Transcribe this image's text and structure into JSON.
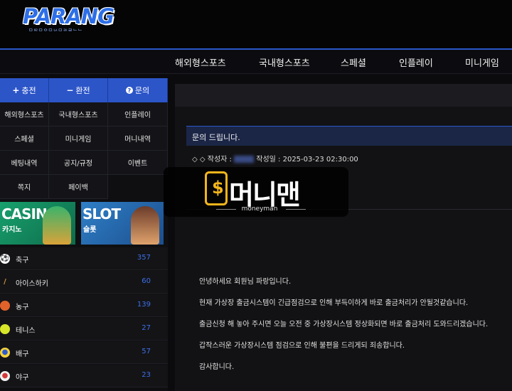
{
  "brand": {
    "logo_text": "PARANG",
    "logo_tagline": "ᄆᄋᄅᄆᄋᄆᄂᄉᄆᄅᄉᄅᄂᄂ",
    "accent": "#2c55c8"
  },
  "nav": {
    "items": [
      "해외형스포츠",
      "국내형스포츠",
      "스페셜",
      "인플레이",
      "미니게임"
    ]
  },
  "sidebar": {
    "actions": [
      {
        "icon": "plus-icon",
        "glyph": "+",
        "label": "충전"
      },
      {
        "icon": "minus-icon",
        "glyph": "−",
        "label": "환전"
      },
      {
        "icon": "question-icon",
        "glyph": "?",
        "label": "문의"
      }
    ],
    "menu": [
      "해외형스포츠",
      "국내형스포츠",
      "인플레이",
      "스페셜",
      "미니게임",
      "머니내역",
      "베팅내역",
      "공지/규정",
      "이벤트",
      "쪽지",
      "페이백"
    ],
    "banners": [
      {
        "title": "CASINO",
        "subtitle": "카지노"
      },
      {
        "title": "SLOT",
        "subtitle": "슬롯"
      }
    ],
    "sports": [
      {
        "icon": "soccer-ball-icon",
        "glyph": "⚽",
        "name": "축구",
        "count": "357"
      },
      {
        "icon": "hockey-stick-icon",
        "glyph": "/",
        "name": "아이스하키",
        "count": "60"
      },
      {
        "icon": "basketball-icon",
        "glyph": "●",
        "name": "농구",
        "count": "139"
      },
      {
        "icon": "tennis-ball-icon",
        "glyph": "●",
        "name": "테니스",
        "count": "27"
      },
      {
        "icon": "volleyball-icon",
        "glyph": "●",
        "name": "배구",
        "count": "57"
      },
      {
        "icon": "baseball-icon",
        "glyph": "●",
        "name": "야구",
        "count": "23"
      }
    ]
  },
  "post": {
    "title": "문의 드립니다.",
    "meta_prefix": "◇ ◇ 작성자 :",
    "meta_date": "작성일 : 2025-03-23 02:30:00",
    "body": [
      "안녕하세요 회원님 파랑입니다.",
      "현재 가상장 출금시스템이 긴급점검으로 인해 부득이하게 바로 출금처리가 안될것같습니다.",
      "출금신청 해 놓아 주시면 오늘 오전 중 가상장시스템 정상화되면 바로 출금처리 도와드리겠습니다.",
      "갑작스러운 가상장시스템 점검으로 인해 불편을 드리게되 죄송합니다.",
      "감사합니다."
    ]
  },
  "watermark": {
    "text": "머니맨",
    "sub": "moneyman"
  }
}
